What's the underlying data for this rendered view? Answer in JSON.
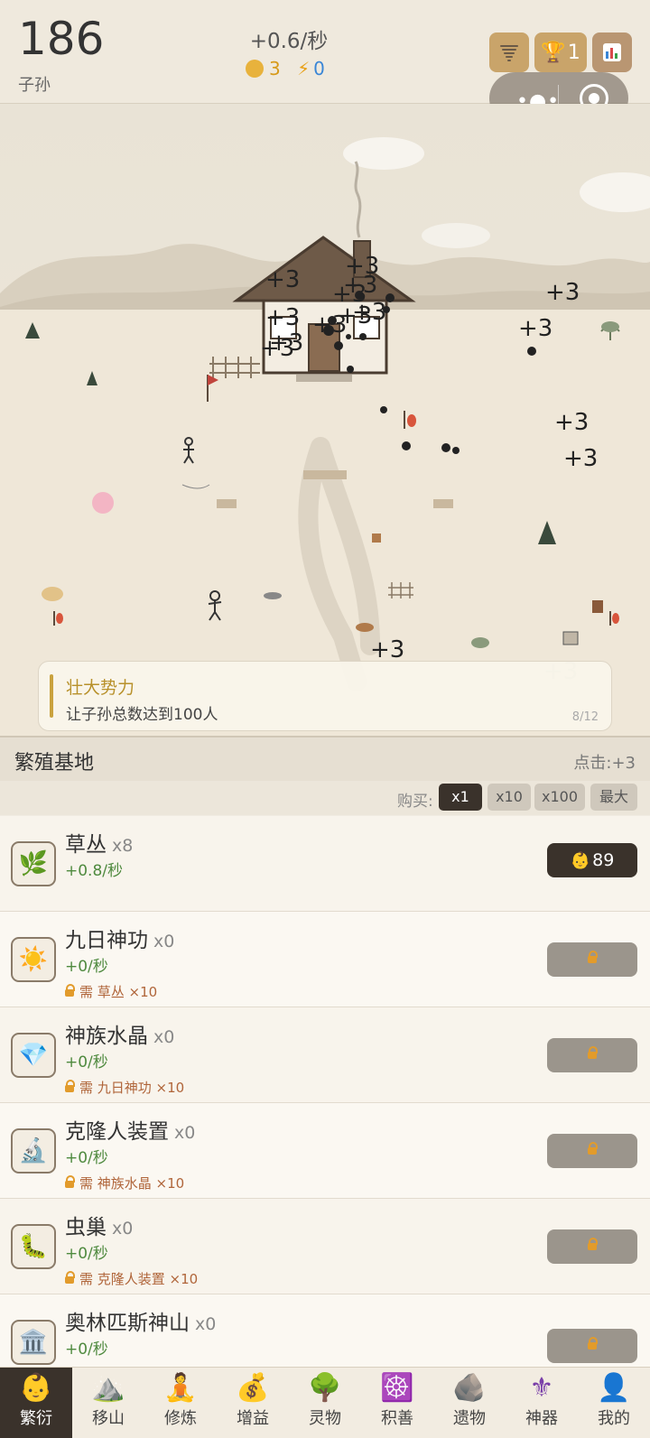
{
  "header": {
    "count": "186",
    "count_label": "子孙",
    "rate": "+0.6/秒",
    "coins": "3",
    "energy": "0",
    "trophy_count": "1"
  },
  "scene": {
    "floating_texts": [
      "+3",
      "+3",
      "+3",
      "+3",
      "+3",
      "+3",
      "+3",
      "+3",
      "+3",
      "+3",
      "+3",
      "+3",
      "+3",
      "+3",
      "+3",
      "+3"
    ]
  },
  "quest": {
    "title": "壮大势力",
    "desc": "让子孙总数达到100人",
    "progress": "8/12"
  },
  "panel": {
    "title": "繁殖基地",
    "tap_value": "点击:+3",
    "buy_label": "购买:",
    "multipliers": [
      "x1",
      "x10",
      "x100",
      "最大"
    ]
  },
  "items": [
    {
      "name": "草丛",
      "count": "x8",
      "rate": "+0.8/秒",
      "req": "",
      "price": "89",
      "icon": "herb-icon"
    },
    {
      "name": "九日神功",
      "count": "x0",
      "rate": "+0/秒",
      "req": "需 草丛 ×10",
      "price": "",
      "icon": "sun-icon"
    },
    {
      "name": "神族水晶",
      "count": "x0",
      "rate": "+0/秒",
      "req": "需 九日神功 ×10",
      "price": "",
      "icon": "gem-icon"
    },
    {
      "name": "克隆人装置",
      "count": "x0",
      "rate": "+0/秒",
      "req": "需 神族水晶 ×10",
      "price": "",
      "icon": "microscope-icon"
    },
    {
      "name": "虫巢",
      "count": "x0",
      "rate": "+0/秒",
      "req": "需 克隆人装置 ×10",
      "price": "",
      "icon": "worm-icon"
    },
    {
      "name": "奥林匹斯神山",
      "count": "x0",
      "rate": "+0/秒",
      "req": "",
      "price": "",
      "icon": "temple-icon"
    }
  ],
  "nav": [
    {
      "label": "繁衍",
      "icon": "baby-icon"
    },
    {
      "label": "移山",
      "icon": "mountain-icon"
    },
    {
      "label": "修炼",
      "icon": "meditate-icon"
    },
    {
      "label": "增益",
      "icon": "moneybag-icon"
    },
    {
      "label": "灵物",
      "icon": "tree-icon"
    },
    {
      "label": "积善",
      "icon": "wheel-icon"
    },
    {
      "label": "遗物",
      "icon": "rock-icon"
    },
    {
      "label": "神器",
      "icon": "fleur-icon"
    },
    {
      "label": "我的",
      "icon": "user-icon"
    }
  ]
}
